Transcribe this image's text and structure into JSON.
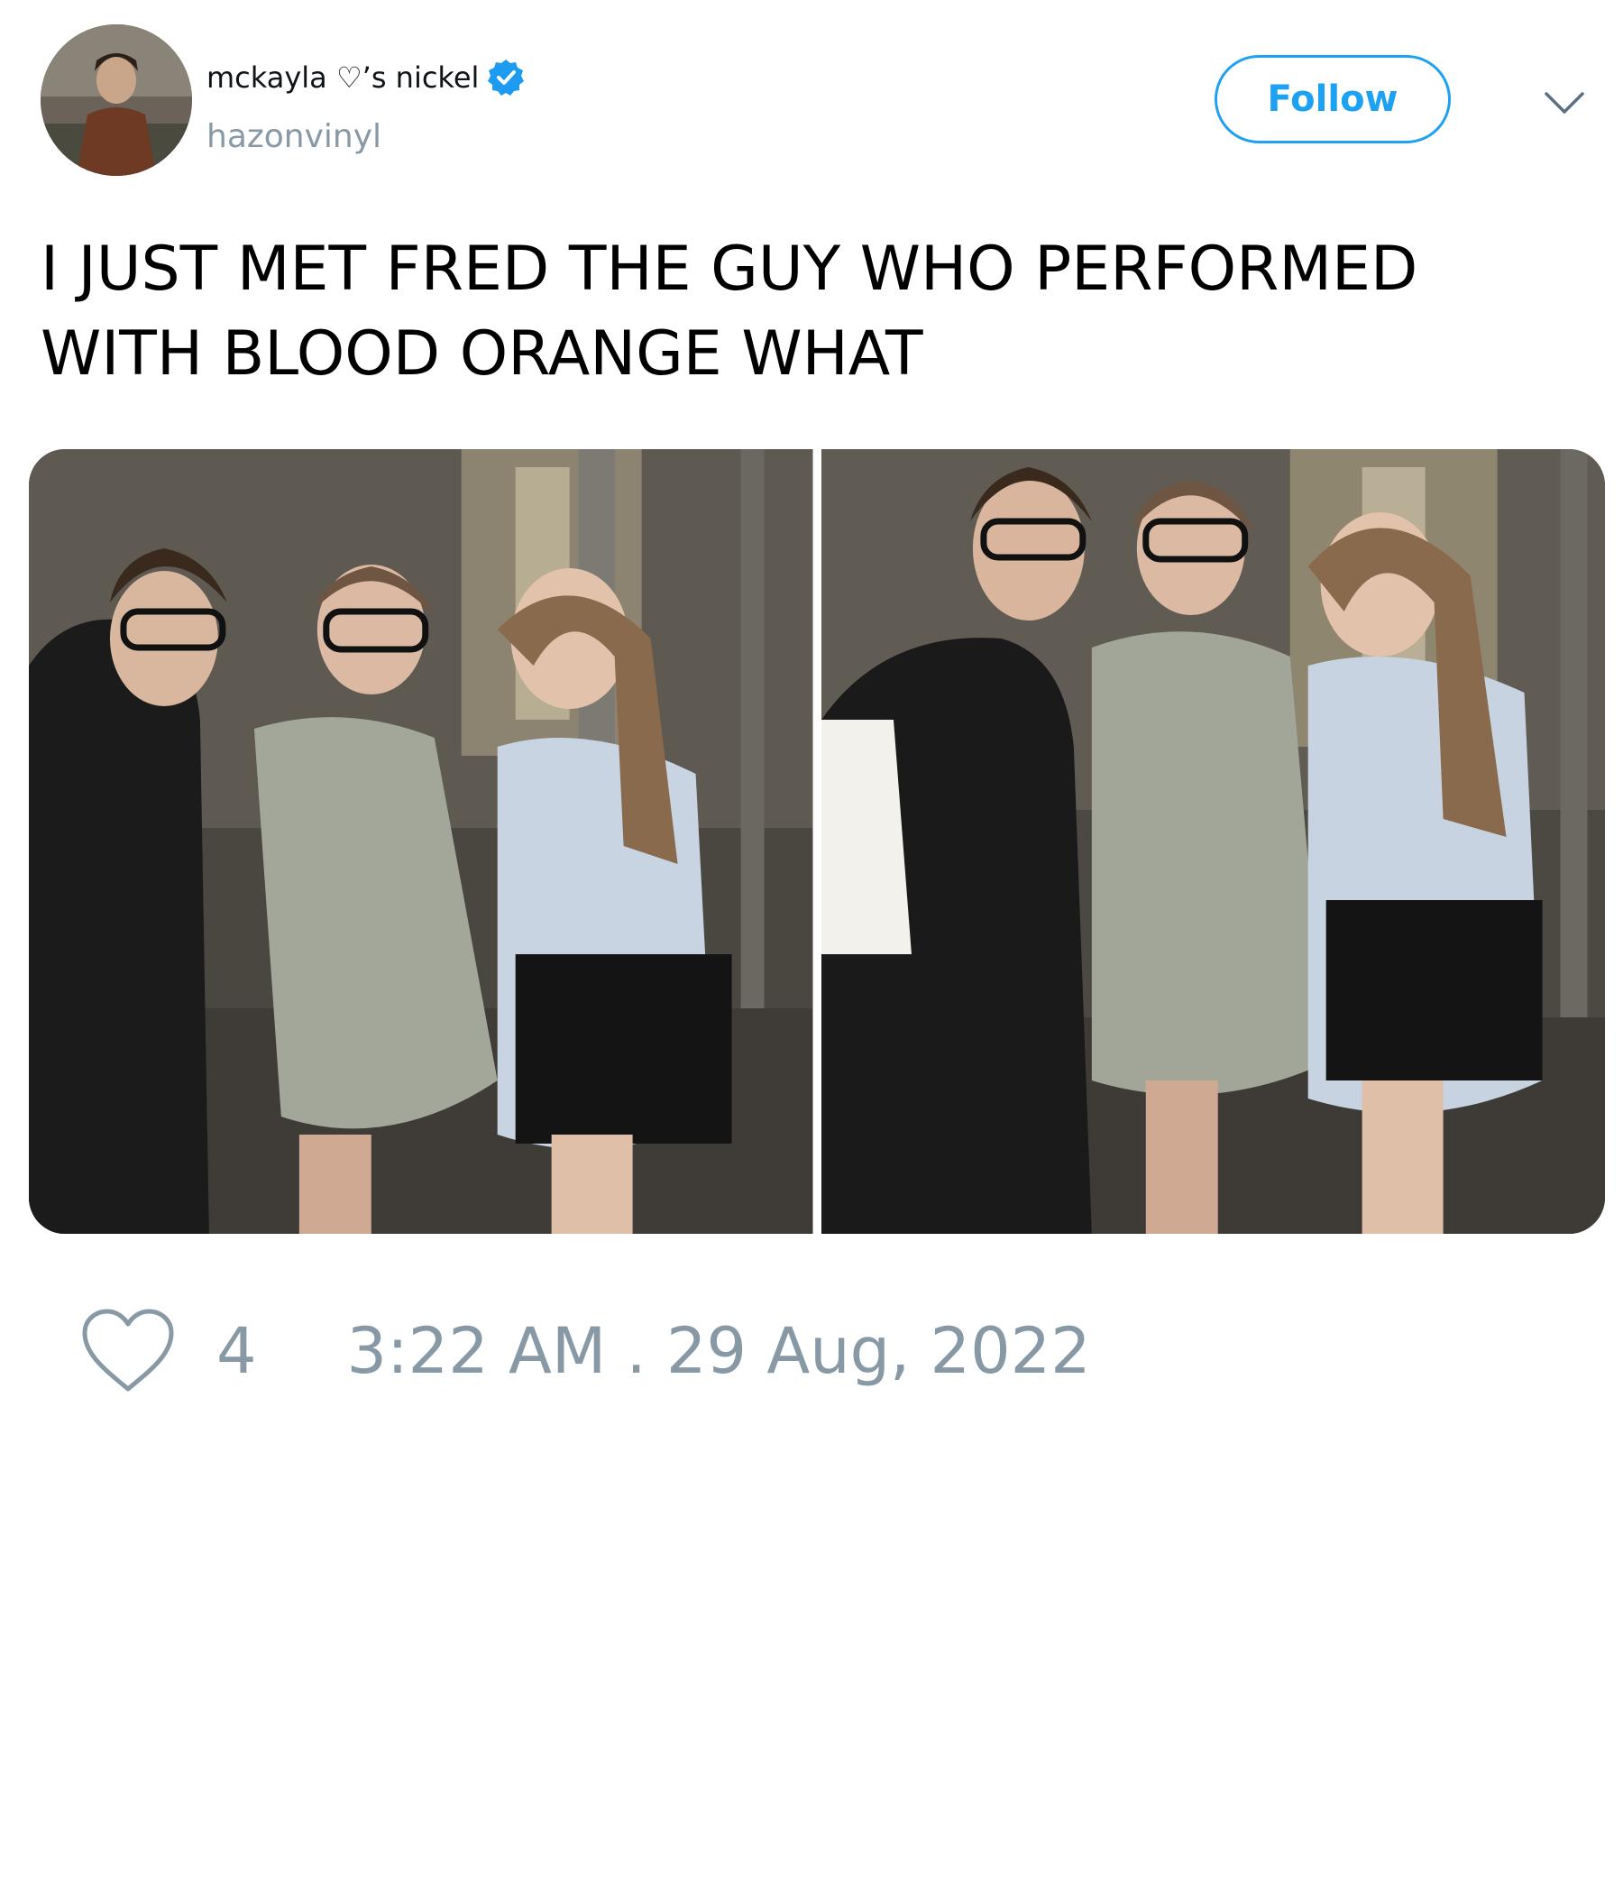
{
  "user": {
    "display_name": "mckayla ♡’s nickel",
    "handle": "hazonvinyl",
    "verified": true,
    "avatar_icon": "profile-photo"
  },
  "header": {
    "follow_label": "Follow",
    "menu_icon": "chevron-down-icon"
  },
  "tweet": {
    "text": "I JUST MET FRED THE GUY WHO PERFORMED WITH BLOOD ORANGE WHAT",
    "media": [
      {
        "type": "photo"
      },
      {
        "type": "photo"
      }
    ]
  },
  "actions": {
    "like_count": "4",
    "timestamp": "3:22 AM . 29 Aug, 2022"
  },
  "colors": {
    "accent": "#1da1f2",
    "muted": "#8899a6",
    "text": "#000000"
  }
}
